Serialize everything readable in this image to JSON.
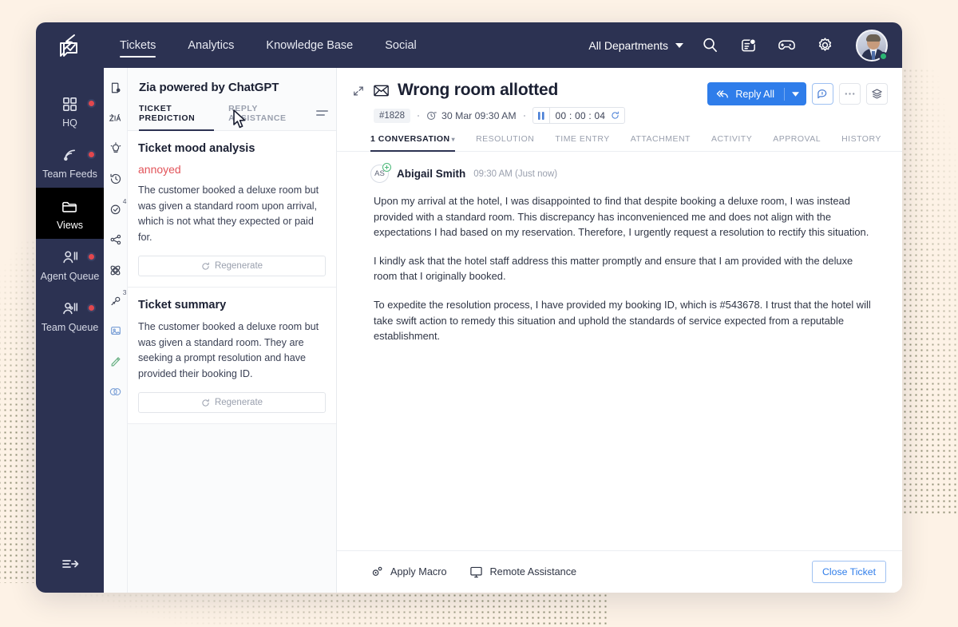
{
  "theme": {
    "page_bg": "#fdf2e6",
    "nav_bg": "#2c3252",
    "accent_blue": "#2f7dea",
    "badge_red": "#e2474d",
    "mood_red": "#e2545a",
    "status_green": "#2bb673"
  },
  "topnav": {
    "logo": "zoho-desk-logo-icon",
    "tabs": [
      {
        "label": "Tickets",
        "active": true
      },
      {
        "label": "Analytics",
        "active": false
      },
      {
        "label": "Knowledge Base",
        "active": false
      },
      {
        "label": "Social",
        "active": false
      }
    ],
    "department_selector": "All Departments",
    "icons": [
      "search-icon",
      "notifications-icon",
      "gamification-icon",
      "settings-gear-icon"
    ],
    "notification_badge": true,
    "avatar_status": "online"
  },
  "sidebar": {
    "items": [
      {
        "label": "HQ",
        "icon": "grid-icon",
        "badge": true,
        "active": false
      },
      {
        "label": "Team Feeds",
        "icon": "feed-icon",
        "badge": true,
        "active": false
      },
      {
        "label": "Views",
        "icon": "folder-icon",
        "badge": false,
        "active": true
      },
      {
        "label": "Agent Queue",
        "icon": "agent-icon",
        "badge": true,
        "active": false
      },
      {
        "label": "Team Queue",
        "icon": "team-icon",
        "badge": true,
        "active": false
      }
    ],
    "collapse_toggle": "collapse-sidebar-icon"
  },
  "rail": {
    "icons": [
      {
        "name": "ticket-properties-icon",
        "badge": ""
      },
      {
        "name": "zia-icon",
        "badge": ""
      },
      {
        "name": "suggestion-bulb-icon",
        "badge": ""
      },
      {
        "name": "history-clock-icon",
        "badge": ""
      },
      {
        "name": "tasks-check-icon",
        "badge": "4"
      },
      {
        "name": "share-network-icon",
        "badge": ""
      },
      {
        "name": "community-atom-icon",
        "badge": ""
      },
      {
        "name": "pin-icon",
        "badge": "3"
      },
      {
        "name": "card-image-icon",
        "badge": ""
      },
      {
        "name": "signature-icon",
        "badge": ""
      },
      {
        "name": "link-preview-icon",
        "badge": ""
      }
    ]
  },
  "zia": {
    "title": "Zia powered by ChatGPT",
    "tabs": [
      {
        "label": "TICKET PREDICTION",
        "active": true
      },
      {
        "label": "REPLY ASSISTANCE",
        "active": false
      }
    ],
    "menu_icon": "list-options-icon",
    "cards": [
      {
        "title": "Ticket mood analysis",
        "mood": "annoyed",
        "text": "The customer booked a deluxe room but was given a standard room upon arrival, which is not what they expected or paid for.",
        "button": "Regenerate"
      },
      {
        "title": "Ticket summary",
        "mood": "",
        "text": "The customer booked a deluxe room but was given a standard room. They are seeking a  prompt resolution and have provided their booking ID.",
        "button": "Regenerate"
      }
    ]
  },
  "ticket": {
    "expand_icon": "expand-collapse-icon",
    "channel_icon": "email-icon",
    "title": "Wrong room allotted",
    "id": "#1828",
    "date": "30 Mar 09:30 AM",
    "timer_value": "00 : 00 : 04",
    "timer_pause_icon": "pause-icon",
    "timer_reset_icon": "reset-icon",
    "actions": {
      "reply_all": "Reply All",
      "reply_all_icon": "reply-all-icon",
      "dropdown_icon": "chevron-down-icon",
      "chat_icon": "chat-bubble-icon",
      "more_icon": "more-options-icon",
      "layers_icon": "layers-icon"
    },
    "tabs": [
      {
        "label": "1 CONVERSATION",
        "active": true,
        "caret": true
      },
      {
        "label": "RESOLUTION",
        "active": false,
        "caret": false
      },
      {
        "label": "TIME ENTRY",
        "active": false,
        "caret": false
      },
      {
        "label": "ATTACHMENT",
        "active": false,
        "caret": false
      },
      {
        "label": "ACTIVITY",
        "active": false,
        "caret": false
      },
      {
        "label": "APPROVAL",
        "active": false,
        "caret": false
      },
      {
        "label": "HISTORY",
        "active": false,
        "caret": false
      }
    ],
    "tab_menu_icon": "list-options-icon"
  },
  "conversation": {
    "avatar_initials": "AS",
    "sender": "Abigail Smith",
    "timestamp": "09:30 AM (Just now)",
    "paragraphs": [
      "Upon my arrival at the hotel, I was disappointed to find that despite booking a deluxe room, I was instead provided with a standard room. This discrepancy has inconvenienced me and does not align with the expectations I had based on my reservation. Therefore, I urgently request a resolution to rectify this situation.",
      "I kindly ask that the hotel staff address this matter promptly and ensure that I am provided with the deluxe room that I originally booked.",
      "To expedite the resolution process, I have provided my booking ID, which is #543678. I trust that the hotel will take swift action to remedy this situation and uphold the standards of service expected from a reputable establishment."
    ]
  },
  "footer": {
    "apply_macro": "Apply Macro",
    "apply_macro_icon": "macro-gear-icon",
    "remote_assistance": "Remote Assistance",
    "remote_assistance_icon": "monitor-icon",
    "close_ticket": "Close Ticket"
  }
}
